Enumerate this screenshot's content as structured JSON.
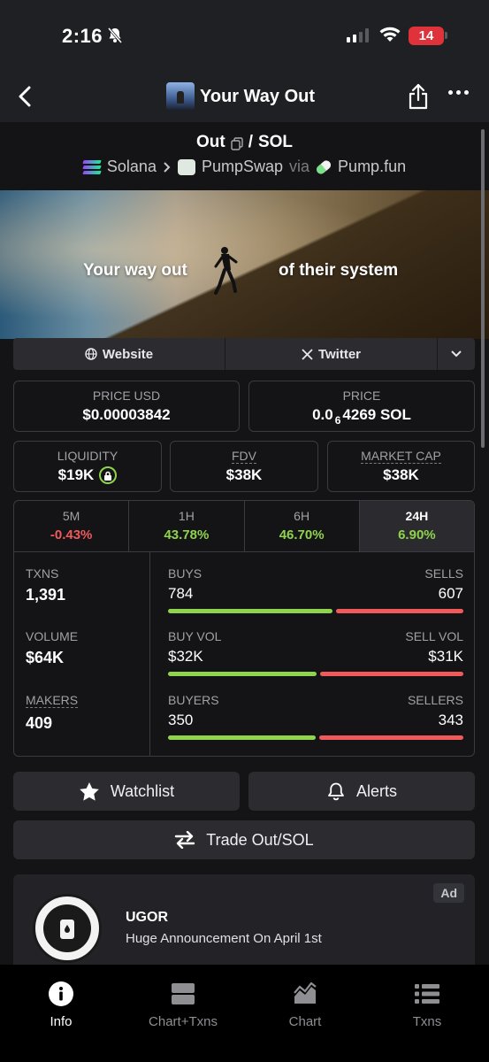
{
  "status_bar": {
    "time": "2:16",
    "battery": "14"
  },
  "nav": {
    "title": "Your Way Out"
  },
  "pair": {
    "base": "Out",
    "separator": "/",
    "quote": "SOL",
    "chain": "Solana",
    "dex": "PumpSwap",
    "via_label": "via",
    "launchpad": "Pump.fun"
  },
  "banner": {
    "text_left": "Your way out",
    "text_right": "of their system"
  },
  "links": {
    "website": "Website",
    "twitter": "Twitter"
  },
  "price": {
    "usd_label": "PRICE USD",
    "usd_value": "$0.00003842",
    "native_label": "PRICE",
    "native_prefix": "0.0",
    "native_zeros": "6",
    "native_rest": "4269 SOL"
  },
  "metrics": {
    "liquidity_label": "LIQUIDITY",
    "liquidity_value": "$19K",
    "fdv_label": "FDV",
    "fdv_value": "$38K",
    "mcap_label": "MARKET CAP",
    "mcap_value": "$38K"
  },
  "timeframes": [
    {
      "label": "5M",
      "value": "-0.43%"
    },
    {
      "label": "1H",
      "value": "43.78%"
    },
    {
      "label": "6H",
      "value": "46.70%"
    },
    {
      "label": "24H",
      "value": "6.90%"
    }
  ],
  "stats": {
    "txns_label": "TXNS",
    "txns_value": "1,391",
    "volume_label": "VOLUME",
    "volume_value": "$64K",
    "makers_label": "MAKERS",
    "makers_value": "409",
    "buys_label": "BUYS",
    "buys_value": "784",
    "sells_label": "SELLS",
    "sells_value": "607",
    "buy_vol_label": "BUY VOL",
    "buy_vol_value": "$32K",
    "sell_vol_label": "SELL VOL",
    "sell_vol_value": "$31K",
    "buyers_label": "BUYERS",
    "buyers_value": "350",
    "sellers_label": "SELLERS",
    "sellers_value": "343",
    "colors": {
      "positive": "#8fd44a",
      "negative": "#f05a5a"
    }
  },
  "actions": {
    "watchlist": "Watchlist",
    "alerts": "Alerts",
    "trade": "Trade Out/SOL"
  },
  "ad": {
    "badge": "Ad",
    "name": "UGOR",
    "description": "Huge Announcement On April 1st"
  },
  "tabs": [
    {
      "label": "Info",
      "icon": "info-icon"
    },
    {
      "label": "Chart+Txns",
      "icon": "chart-txns-icon"
    },
    {
      "label": "Chart",
      "icon": "chart-icon"
    },
    {
      "label": "Txns",
      "icon": "list-icon"
    }
  ]
}
